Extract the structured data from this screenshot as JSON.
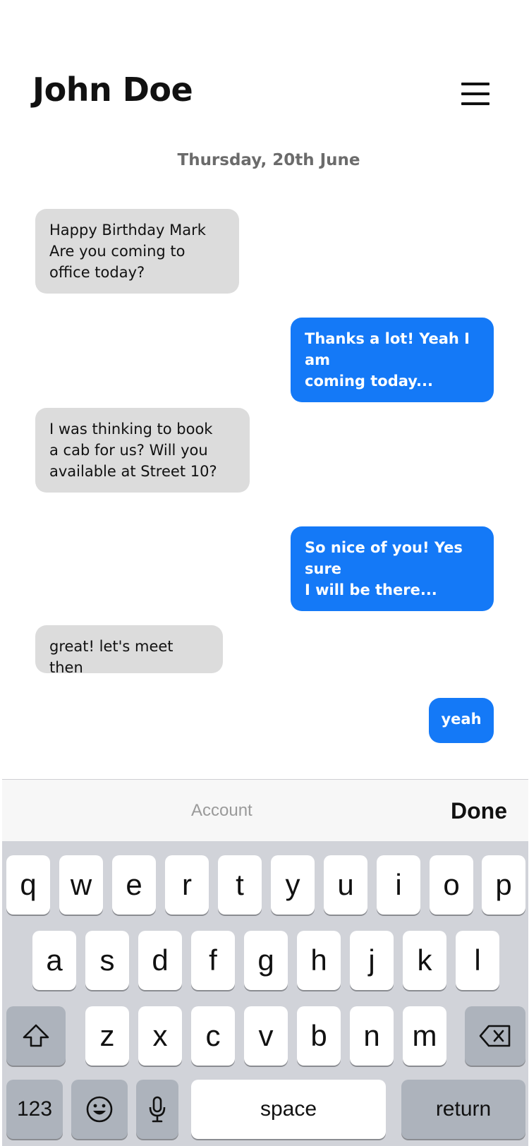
{
  "header": {
    "title": "John Doe",
    "menu_icon": "hamburger-menu-icon"
  },
  "conversation": {
    "date": "Thursday, 20th June",
    "messages": [
      {
        "side": "received",
        "lines": [
          "Happy Birthday Mark",
          "Are you coming to",
          "office today?"
        ]
      },
      {
        "side": "sent",
        "lines": [
          "Thanks a lot! Yeah I am",
          "coming today..."
        ]
      },
      {
        "side": "received",
        "lines": [
          "I was thinking to book",
          "a cab for us? Will you",
          "available at Street 10?"
        ]
      },
      {
        "side": "sent",
        "lines": [
          "So nice of you! Yes sure",
          "I will be there..."
        ]
      },
      {
        "side": "received",
        "lines": [
          "great! let's meet then"
        ]
      },
      {
        "side": "sent",
        "lines": [
          "yeah"
        ]
      }
    ]
  },
  "toolbar": {
    "account_label": "Account",
    "done_label": "Done"
  },
  "keyboard": {
    "row1": [
      "q",
      "w",
      "e",
      "r",
      "t",
      "y",
      "u",
      "i",
      "o",
      "p"
    ],
    "row2": [
      "a",
      "s",
      "d",
      "f",
      "g",
      "h",
      "j",
      "k",
      "l"
    ],
    "row3": [
      "z",
      "x",
      "c",
      "v",
      "b",
      "n",
      "m"
    ],
    "numbers_label": "123",
    "space_label": "space",
    "return_label": "return",
    "icons": {
      "shift": "shift-icon",
      "backspace": "backspace-icon",
      "emoji": "emoji-icon",
      "mic": "microphone-icon"
    }
  },
  "colors": {
    "sent_bubble": "#1479f7",
    "received_bubble": "#dcdcdc",
    "keyboard_bg": "#d1d3d9"
  }
}
